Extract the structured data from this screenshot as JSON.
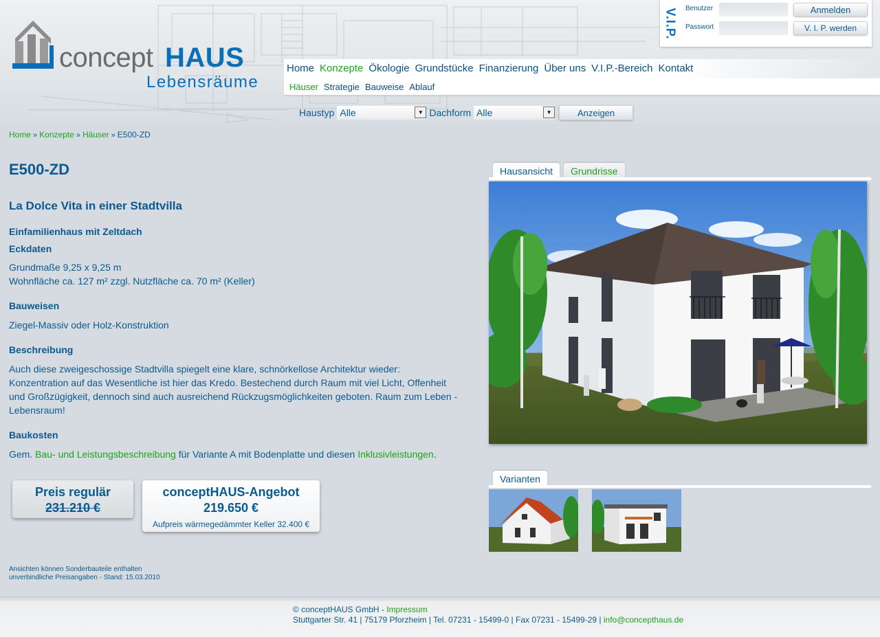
{
  "brand": {
    "name_part1": "concept",
    "name_part2": "HAUS",
    "tagline": "Lebensräume",
    "colors": {
      "primary": "#0b6fb8",
      "text": "#0b5a8f",
      "link": "#1aa51a",
      "grey": "#6a6a6a"
    }
  },
  "login": {
    "vip_label": "V.I.P.",
    "user_label": "Benutzer",
    "password_label": "Passwort",
    "user_value": "",
    "password_value": "",
    "login_button": "Anmelden",
    "vip_button": "V. I. P. werden"
  },
  "nav": {
    "main": [
      "Home",
      "Konzepte",
      "Ökologie",
      "Grundstücke",
      "Finanzierung",
      "Über uns",
      "V.I.P.-Bereich",
      "Kontakt"
    ],
    "main_active": "Konzepte",
    "sub": [
      "Häuser",
      "Strategie",
      "Bauweise",
      "Ablauf"
    ],
    "sub_active": "Häuser"
  },
  "filter": {
    "haustyp_label": "Haustyp",
    "haustyp_value": "Alle",
    "dachform_label": "Dachform",
    "dachform_value": "Alle",
    "button": "Anzeigen"
  },
  "breadcrumb": [
    "Home",
    "Konzepte",
    "Häuser",
    "E500-ZD"
  ],
  "content": {
    "title": "E500-ZD",
    "subtitle": "La Dolce Vita in einer Stadtvilla",
    "house_type": "Einfamilienhaus mit Zeltdach",
    "eckdaten_heading": "Eckdaten",
    "eckdaten_line1": "Grundmaße 9,25 x 9,25 m",
    "eckdaten_line2": "Wohnfläche ca. 127 m²  zzgl. Nutzfläche ca. 70 m² (Keller)",
    "bauweisen_heading": "Bauweisen",
    "bauweisen_text": "Ziegel-Massiv oder Holz-Konstruktion",
    "beschreibung_heading": "Beschreibung",
    "beschreibung_text": "Auch diese zweigeschossige Stadtvilla spiegelt eine klare, schnörkellose Architektur wieder: Konzentration auf das Wesentliche ist hier das Kredo. Bestechend durch Raum mit viel Licht, Offenheit und Großzügigkeit, dennoch sind auch ausreichend Rückzugsmöglichkeiten geboten. Raum zum Leben - Lebensraum!",
    "baukosten_heading": "Baukosten",
    "baukosten_prefix": "Gem.",
    "baukosten_link1": "Bau- und Leistungsbeschreibung",
    "baukosten_middle": "für Variante A mit Bodenplatte und diesen",
    "baukosten_link2": "Inklusivleistungen",
    "baukosten_suffix": "."
  },
  "prices": {
    "regular_label": "Preis regulär",
    "regular_value": "231.210 €",
    "offer_label": "conceptHAUS-Angebot",
    "offer_value": "219.650 €",
    "offer_note": "Aufpreis wärmegedämmter Keller 32.400 €"
  },
  "footnote": {
    "line1": "Ansichten können Sonderbauteile enthalten",
    "line2": "unverbindliche Preisangaben - Stand: 15.03.2010"
  },
  "view_tabs": [
    "Hausansicht",
    "Grundrisse"
  ],
  "view_tab_active": "Hausansicht",
  "variants_tab": "Varianten",
  "footer": {
    "copyright": "© conceptHAUS GmbH - ",
    "impressum": "Impressum",
    "address": "Stuttgarter Str. 41 | 75179 Pforzheim | Tel. 07231 - 15499-0 | Fax 07231 - 15499-29 | ",
    "email": "info@concepthaus.de"
  }
}
